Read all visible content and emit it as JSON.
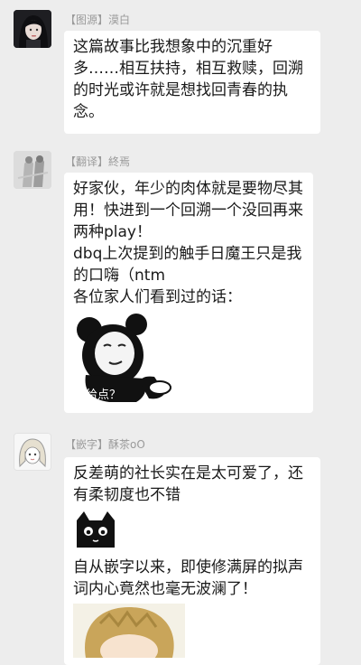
{
  "messages": [
    {
      "tag": "【图源】",
      "name": "漠白",
      "avatar_icon": "dark-haired-girl-avatar",
      "lines": [
        "这篇故事比我想象中的沉重好多……相互扶持，相互救赎，回溯的时光或许就是想找回青春的执念。"
      ]
    },
    {
      "tag": "【翻译】",
      "name": "終焉",
      "avatar_icon": "sketch-figure-avatar",
      "lines": [
        "好家伙，年少的肉体就是要物尽其用！快进到一个回溯一个没回再来两种play！",
        "dbq上次提到的触手日魔王只是我的口嗨（ntm",
        "各位家人们看到过的话："
      ],
      "sticker_caption": "给点？"
    },
    {
      "tag": "【嵌字】",
      "name": "酥茶oO",
      "avatar_icon": "anime-girl-avatar",
      "lines_a": [
        "反差萌的社长实在是太可爱了，还有柔韧度也不错"
      ],
      "lines_b": [
        "自从嵌字以来，即使修满屏的拟声词内心竟然也毫无波澜了！"
      ]
    }
  ],
  "colors": {
    "background": "#ededed",
    "bubble": "#ffffff",
    "tag_text": "#9a9a9a",
    "message_text": "#1a1a1a"
  }
}
